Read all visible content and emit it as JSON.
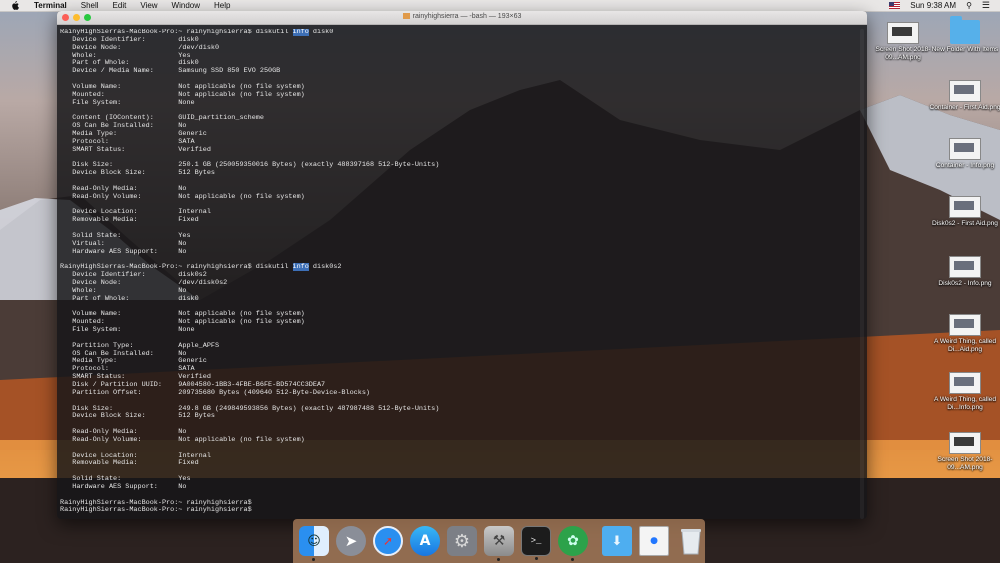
{
  "menubar": {
    "app": "Terminal",
    "items": [
      "Shell",
      "Edit",
      "View",
      "Window",
      "Help"
    ],
    "clock": "Sun 9:38 AM"
  },
  "window": {
    "title": "rainyhighsierra — -bash — 193×63"
  },
  "terminal": {
    "lines": [
      "RainyHighSierras-MacBook-Pro:~ rainyhighsierra$ diskutil info disk0",
      "   Device Identifier:        disk0",
      "   Device Node:              /dev/disk0",
      "   Whole:                    Yes",
      "   Part of Whole:            disk0",
      "   Device / Media Name:      Samsung SSD 850 EVO 250GB",
      "",
      "   Volume Name:              Not applicable (no file system)",
      "   Mounted:                  Not applicable (no file system)",
      "   File System:              None",
      "",
      "   Content (IOContent):      GUID_partition_scheme",
      "   OS Can Be Installed:      No",
      "   Media Type:               Generic",
      "   Protocol:                 SATA",
      "   SMART Status:             Verified",
      "",
      "   Disk Size:                250.1 GB (250059350016 Bytes) (exactly 488397168 512-Byte-Units)",
      "   Device Block Size:        512 Bytes",
      "",
      "   Read-Only Media:          No",
      "   Read-Only Volume:         Not applicable (no file system)",
      "",
      "   Device Location:          Internal",
      "   Removable Media:          Fixed",
      "",
      "   Solid State:              Yes",
      "   Virtual:                  No",
      "   Hardware AES Support:     No",
      "",
      "RainyHighSierras-MacBook-Pro:~ rainyhighsierra$ diskutil info disk0s2",
      "   Device Identifier:        disk0s2",
      "   Device Node:              /dev/disk0s2",
      "   Whole:                    No",
      "   Part of Whole:            disk0",
      "",
      "   Volume Name:              Not applicable (no file system)",
      "   Mounted:                  Not applicable (no file system)",
      "   File System:              None",
      "",
      "   Partition Type:           Apple_APFS",
      "   OS Can Be Installed:      No",
      "   Media Type:               Generic",
      "   Protocol:                 SATA",
      "   SMART Status:             Verified",
      "   Disk / Partition UUID:    9A004580-1BB3-4FBE-B6FE-BD574CC3DEA7",
      "   Partition Offset:         209735680 Bytes (409640 512-Byte-Device-Blocks)",
      "",
      "   Disk Size:                249.8 GB (249849593856 Bytes) (exactly 487987488 512-Byte-Units)",
      "   Device Block Size:        512 Bytes",
      "",
      "   Read-Only Media:          No",
      "   Read-Only Volume:         Not applicable (no file system)",
      "",
      "   Device Location:          Internal",
      "   Removable Media:          Fixed",
      "",
      "   Solid State:              Yes",
      "   Hardware AES Support:     No",
      "",
      "RainyHighSierras-MacBook-Pro:~ rainyhighsierra$",
      "RainyHighSierras-MacBook-Pro:~ rainyhighsierra$"
    ],
    "highlight": "info"
  },
  "desktop_icons": [
    {
      "label": "Screen Shot 2018-09...AM.png",
      "kind": "shot"
    },
    {
      "label": "New Folder With Items",
      "kind": "folder"
    },
    {
      "label": "Container - First Aid.png",
      "kind": "image"
    },
    {
      "label": "Container - Info.png",
      "kind": "image"
    },
    {
      "label": "Disk0s2 - First Aid.png",
      "kind": "image"
    },
    {
      "label": "Disk0s2 - Info.png",
      "kind": "image"
    },
    {
      "label": "A Weird Thing, called Di...Aid.png",
      "kind": "image"
    },
    {
      "label": "A Weird Thing, called Di...Info.png",
      "kind": "image"
    },
    {
      "label": "Screen Shot 2018-09...AM.png",
      "kind": "shot"
    }
  ],
  "dock": {
    "apps": [
      "finder-icon",
      "launchpad-icon",
      "safari-icon",
      "app-store-icon",
      "system-preferences-icon",
      "disk-utility-icon",
      "terminal-icon",
      "scrobbles-icon",
      "downloads-folder-icon",
      "preview-icon",
      "trash-icon"
    ]
  },
  "colors": {
    "selection": "#3d6fb6",
    "terminal_bg": "#161618",
    "traffic_red": "#fc5f57",
    "traffic_yellow": "#fdbc2e",
    "traffic_green": "#28c840"
  }
}
